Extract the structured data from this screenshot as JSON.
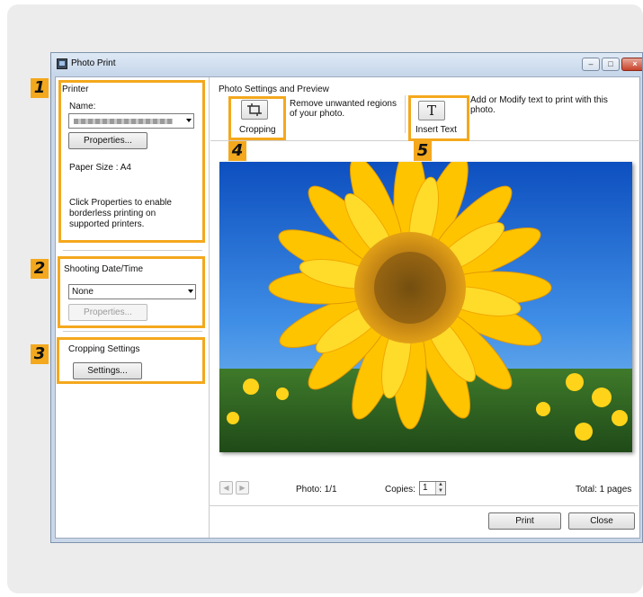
{
  "window": {
    "title": "Photo Print"
  },
  "printer": {
    "section_label": "Printer",
    "name_label": "Name:",
    "properties_button": "Properties...",
    "paper_size": "Paper Size : A4",
    "hint_lines": [
      "Click Properties to enable",
      "borderless printing on",
      "supported printers."
    ]
  },
  "shooting": {
    "section_label": "Shooting Date/Time",
    "select_value": "None",
    "properties_button": "Properties..."
  },
  "cropping": {
    "section_label": "Cropping Settings",
    "settings_button": "Settings..."
  },
  "preview": {
    "section_label": "Photo Settings and Preview",
    "crop_button_label": "Cropping",
    "crop_desc_lines": [
      "Remove unwanted regions",
      "of your photo."
    ],
    "text_button_label": "Insert Text",
    "text_icon_glyph": "T",
    "text_desc_lines": [
      "Add or Modify text to print with this",
      "photo."
    ]
  },
  "footer": {
    "photo_counter": "Photo: 1/1",
    "copies_label": "Copies:",
    "copies_value": "1",
    "total": "Total: 1 pages",
    "print_button": "Print",
    "close_button": "Close"
  },
  "callouts": [
    "1",
    "2",
    "3",
    "4",
    "5"
  ],
  "colors": {
    "callout": "#f4a81d"
  }
}
